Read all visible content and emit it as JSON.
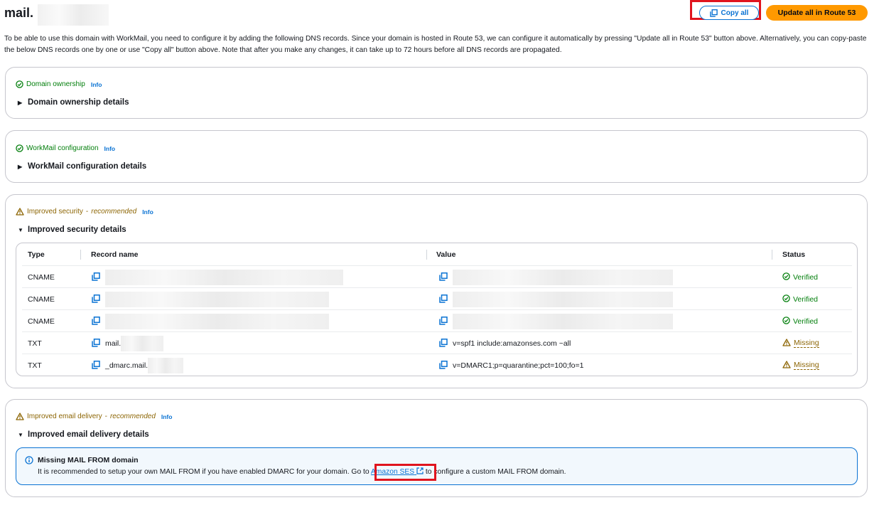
{
  "header": {
    "title": "mail.",
    "copy_all_label": "Copy all",
    "update_route53_label": "Update all in Route 53"
  },
  "description": "To be able to use this domain with WorkMail, you need to configure it by adding the following DNS records. Since your domain is hosted in Route 53, we can configure it automatically by pressing \"Update all in Route 53\" button above. Alternatively, you can copy-paste the below DNS records one by one or use \"Copy all\" button above. Note that after you make any changes, it can take up to 72 hours before all DNS records are propagated.",
  "sections": [
    {
      "status_label": "Domain ownership",
      "status": "ok",
      "info_label": "Info",
      "expander_label": "Domain ownership details",
      "expanded": false
    },
    {
      "status_label": "WorkMail configuration",
      "status": "ok",
      "info_label": "Info",
      "expander_label": "WorkMail configuration details",
      "expanded": false
    },
    {
      "status_label": "Improved security",
      "status_suffix": "recommended",
      "status": "warning",
      "info_label": "Info",
      "expander_label": "Improved security details",
      "expanded": true
    },
    {
      "status_label": "Improved email delivery",
      "status_suffix": "recommended",
      "status": "warning",
      "info_label": "Info",
      "expander_label": "Improved email delivery details",
      "expanded": true
    }
  ],
  "security_table": {
    "columns": [
      "Type",
      "Record name",
      "Value",
      "Status"
    ],
    "rows": [
      {
        "type": "CNAME",
        "record_name": "",
        "value": "",
        "status": "Verified"
      },
      {
        "type": "CNAME",
        "record_name": "",
        "value": "",
        "status": "Verified"
      },
      {
        "type": "CNAME",
        "record_name": "",
        "value": "",
        "status": "Verified"
      },
      {
        "type": "TXT",
        "record_name": "mail.",
        "value": "v=spf1 include:amazonses.com ~all",
        "status": "Missing"
      },
      {
        "type": "TXT",
        "record_name": "_dmarc.mail.",
        "value": "v=DMARC1;p=quarantine;pct=100;fo=1",
        "status": "Missing"
      }
    ]
  },
  "alert": {
    "title": "Missing MAIL FROM domain",
    "body_before": "It is recommended to setup your own MAIL FROM if you have enabled DMARC for your domain. Go to ",
    "link_label": "Amazon SES",
    "body_after": " to configure a custom MAIL FROM domain."
  },
  "colors": {
    "primary_blue": "#0972d3",
    "success_green": "#037f0c",
    "warning_brown": "#8d6605",
    "orange_button": "#ff9900",
    "highlight_red": "#e0141e"
  }
}
